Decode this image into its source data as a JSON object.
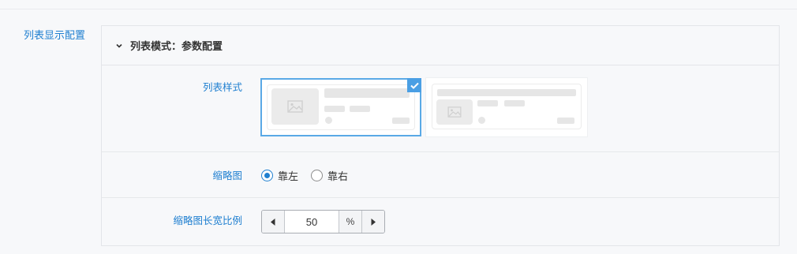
{
  "section": {
    "label": "列表显示配置"
  },
  "panel": {
    "title": "列表模式：参数配置",
    "collapse_icon": "chevron-down-icon"
  },
  "list_style": {
    "label": "列表样式",
    "options": [
      {
        "name": "image-left-layout",
        "selected": true
      },
      {
        "name": "title-top-layout",
        "selected": false
      }
    ],
    "check_icon": "check-icon"
  },
  "thumbnail": {
    "label": "缩略图",
    "options": [
      {
        "label": "靠左",
        "checked": true
      },
      {
        "label": "靠右",
        "checked": false
      }
    ]
  },
  "ratio": {
    "label": "缩略图长宽比例",
    "value": "50",
    "unit": "%",
    "decrement_icon": "caret-left-icon",
    "increment_icon": "caret-right-icon"
  },
  "colors": {
    "accent": "#1f7fd0",
    "selected_border": "#5aa9e6",
    "placeholder": "#e6e6e6"
  }
}
